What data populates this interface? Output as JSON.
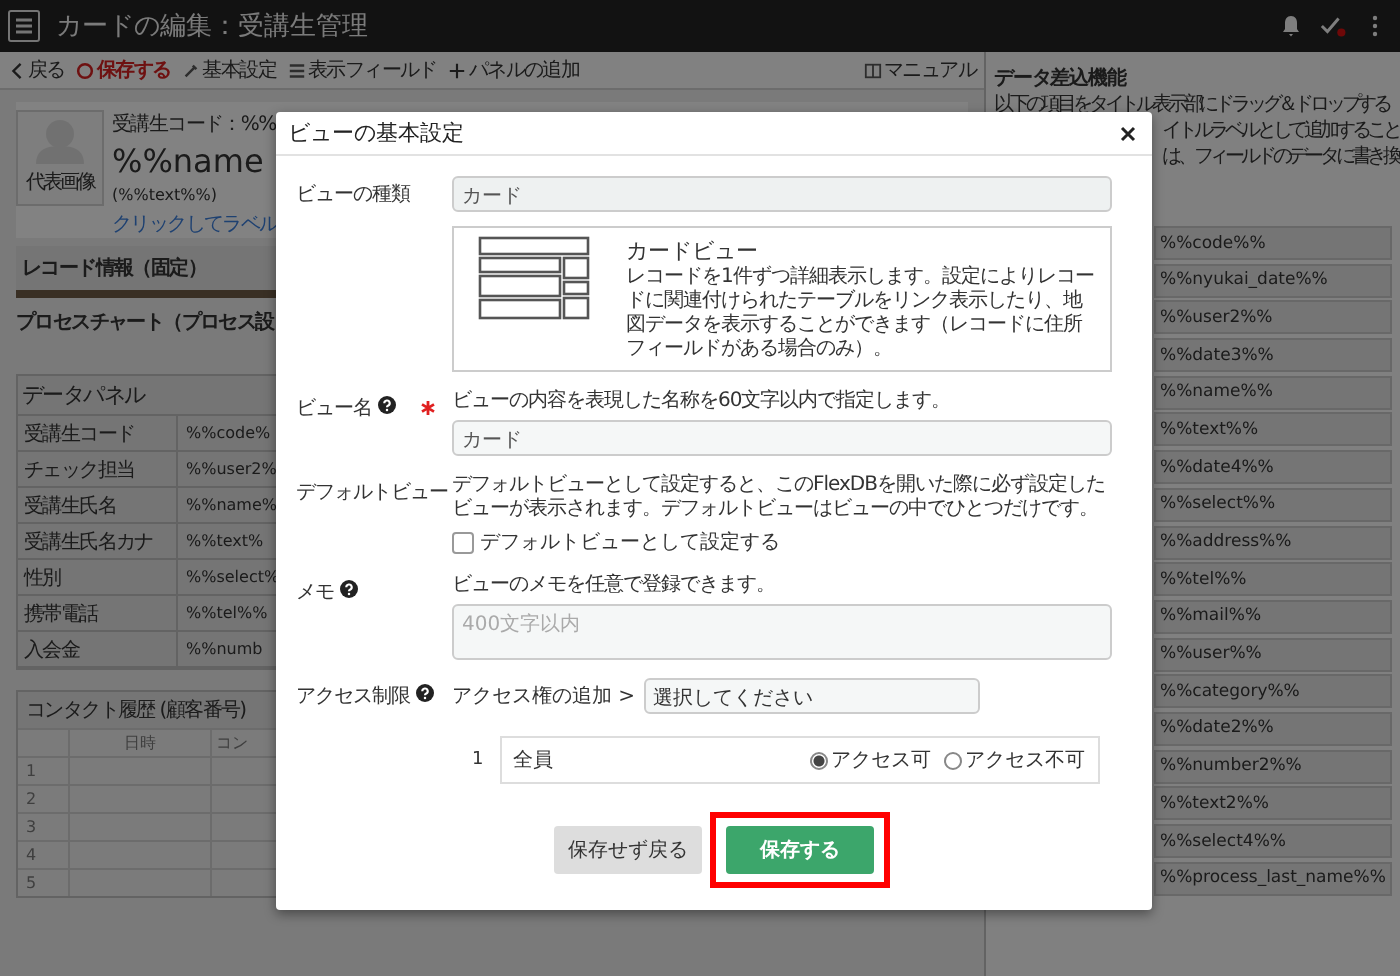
{
  "app_bar": {
    "title": "カードの編集：受講生管理"
  },
  "toolbar": {
    "items": [
      {
        "label": "戻る",
        "kind": "back"
      },
      {
        "label": "保存する",
        "kind": "save"
      },
      {
        "label": "基本設定",
        "kind": "settings"
      },
      {
        "label": "表示フィールド",
        "kind": "fields"
      },
      {
        "label": "パネルの追加",
        "kind": "add"
      }
    ],
    "manual": "マニュアル"
  },
  "card": {
    "image_label": "代表画像",
    "code_line": "受講生コード：%%",
    "name": "%%name",
    "subtitle": "(%%text%%)",
    "label_link": "クリックしてラベル",
    "record_info": "レコード情報（固定）",
    "process_chart": "プロセスチャート（プロセス設"
  },
  "data_panel": {
    "title": "データパネル",
    "rows": [
      {
        "label": "受講生コード",
        "value": "%%code%"
      },
      {
        "label": "チェック担当",
        "value": "%%user2%"
      },
      {
        "label": "受講生氏名",
        "value": "%%name%"
      },
      {
        "label": "受講生氏名カナ",
        "value": "%%text%"
      },
      {
        "label": "性別",
        "value": "%%select%"
      },
      {
        "label": "携帯電話",
        "value": "%%tel%%"
      },
      {
        "label": "入会金",
        "value": "%%numb"
      }
    ]
  },
  "contact_history": {
    "title": "コンタクト履歴 (顧客番号)",
    "columns": [
      "日時",
      "コン"
    ],
    "rows": [
      "1",
      "2",
      "3",
      "4",
      "5"
    ]
  },
  "insert_panel": {
    "title": "データ差込機能",
    "lines": [
      "以下の項目をタイトル表示部にドラッグ＆ドロップする",
      "イトルラベルとして追加すること",
      "は、フィールドのデータに書き換"
    ],
    "tags": [
      "%%code%%",
      "%%nyukai_date%%",
      "%%user2%%",
      "%%date3%%",
      "%%name%%",
      "%%text%%",
      "%%date4%%",
      "%%select%%",
      "%%address%%",
      "%%tel%%",
      "%%mail%%",
      "%%user%%",
      "%%category%%",
      "%%date2%%",
      "%%number2%%",
      "%%text2%%",
      "%%select4%%",
      "%%process_last_name%%"
    ]
  },
  "dialog": {
    "title": "ビューの基本設定",
    "view_type": {
      "label": "ビューの種類",
      "value": "カード",
      "card_title": "カードビュー",
      "card_text": "レコードを1件ずつ詳細表示します。設定によりレコードに関連付けられたテーブルをリンク表示したり、地図データを表示することができます（レコードに住所フィールドがある場合のみ）。"
    },
    "view_name": {
      "label": "ビュー名",
      "help": true,
      "required": true,
      "hint": "ビューの内容を表現した名称を60文字以内で指定します。",
      "value": "カード"
    },
    "default_view": {
      "label": "デフォルトビュー",
      "text": "デフォルトビューとして設定すると、このFlexDBを開いた際に必ず設定したビューが表示されます。デフォルトビューはビューの中でひとつだけです。",
      "checkbox_label": "デフォルトビューとして設定する",
      "checked": false
    },
    "memo": {
      "label": "メモ",
      "help": true,
      "hint": "ビューのメモを任意で登録できます。",
      "placeholder": "400文字以内"
    },
    "access": {
      "label": "アクセス制限",
      "help": true,
      "add_label": "アクセス権の追加 >",
      "select_placeholder": "選択してください",
      "rows": [
        {
          "index": "1",
          "name": "全員",
          "options": [
            {
              "label": "アクセス可",
              "selected": true
            },
            {
              "label": "アクセス不可",
              "selected": false
            }
          ]
        }
      ]
    },
    "buttons": [
      {
        "label": "保存せず戻る",
        "kind": "secondary"
      },
      {
        "label": "保存する",
        "kind": "primary",
        "highlighted": true
      }
    ]
  }
}
